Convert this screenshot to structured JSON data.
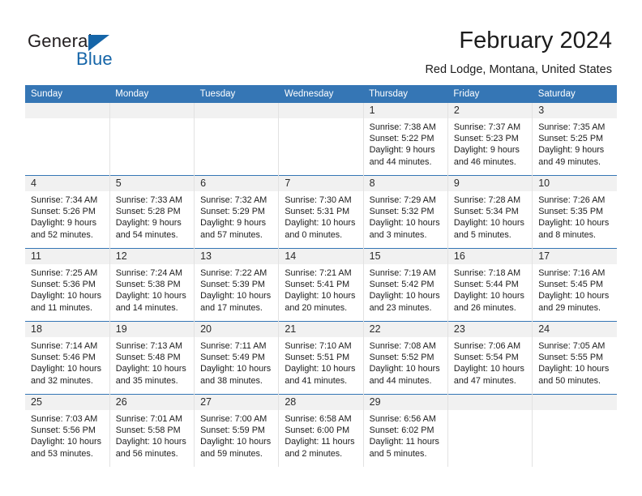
{
  "brand": {
    "name_part1": "General",
    "name_part2": "Blue",
    "logo_icon": "triangle-logo"
  },
  "header": {
    "title": "February 2024",
    "subtitle": "Red Lodge, Montana, United States"
  },
  "colors": {
    "header_band": "#3576b5",
    "daynum_band": "#f1f1f1",
    "brand_blue": "#1565a8",
    "text": "#1c1c1c"
  },
  "weekdays": [
    "Sunday",
    "Monday",
    "Tuesday",
    "Wednesday",
    "Thursday",
    "Friday",
    "Saturday"
  ],
  "weeks": [
    [
      {
        "day": "",
        "blank": true
      },
      {
        "day": "",
        "blank": true
      },
      {
        "day": "",
        "blank": true
      },
      {
        "day": "",
        "blank": true
      },
      {
        "day": "1",
        "sunrise": "Sunrise: 7:38 AM",
        "sunset": "Sunset: 5:22 PM",
        "daylight1": "Daylight: 9 hours",
        "daylight2": "and 44 minutes."
      },
      {
        "day": "2",
        "sunrise": "Sunrise: 7:37 AM",
        "sunset": "Sunset: 5:23 PM",
        "daylight1": "Daylight: 9 hours",
        "daylight2": "and 46 minutes."
      },
      {
        "day": "3",
        "sunrise": "Sunrise: 7:35 AM",
        "sunset": "Sunset: 5:25 PM",
        "daylight1": "Daylight: 9 hours",
        "daylight2": "and 49 minutes."
      }
    ],
    [
      {
        "day": "4",
        "sunrise": "Sunrise: 7:34 AM",
        "sunset": "Sunset: 5:26 PM",
        "daylight1": "Daylight: 9 hours",
        "daylight2": "and 52 minutes."
      },
      {
        "day": "5",
        "sunrise": "Sunrise: 7:33 AM",
        "sunset": "Sunset: 5:28 PM",
        "daylight1": "Daylight: 9 hours",
        "daylight2": "and 54 minutes."
      },
      {
        "day": "6",
        "sunrise": "Sunrise: 7:32 AM",
        "sunset": "Sunset: 5:29 PM",
        "daylight1": "Daylight: 9 hours",
        "daylight2": "and 57 minutes."
      },
      {
        "day": "7",
        "sunrise": "Sunrise: 7:30 AM",
        "sunset": "Sunset: 5:31 PM",
        "daylight1": "Daylight: 10 hours",
        "daylight2": "and 0 minutes."
      },
      {
        "day": "8",
        "sunrise": "Sunrise: 7:29 AM",
        "sunset": "Sunset: 5:32 PM",
        "daylight1": "Daylight: 10 hours",
        "daylight2": "and 3 minutes."
      },
      {
        "day": "9",
        "sunrise": "Sunrise: 7:28 AM",
        "sunset": "Sunset: 5:34 PM",
        "daylight1": "Daylight: 10 hours",
        "daylight2": "and 5 minutes."
      },
      {
        "day": "10",
        "sunrise": "Sunrise: 7:26 AM",
        "sunset": "Sunset: 5:35 PM",
        "daylight1": "Daylight: 10 hours",
        "daylight2": "and 8 minutes."
      }
    ],
    [
      {
        "day": "11",
        "sunrise": "Sunrise: 7:25 AM",
        "sunset": "Sunset: 5:36 PM",
        "daylight1": "Daylight: 10 hours",
        "daylight2": "and 11 minutes."
      },
      {
        "day": "12",
        "sunrise": "Sunrise: 7:24 AM",
        "sunset": "Sunset: 5:38 PM",
        "daylight1": "Daylight: 10 hours",
        "daylight2": "and 14 minutes."
      },
      {
        "day": "13",
        "sunrise": "Sunrise: 7:22 AM",
        "sunset": "Sunset: 5:39 PM",
        "daylight1": "Daylight: 10 hours",
        "daylight2": "and 17 minutes."
      },
      {
        "day": "14",
        "sunrise": "Sunrise: 7:21 AM",
        "sunset": "Sunset: 5:41 PM",
        "daylight1": "Daylight: 10 hours",
        "daylight2": "and 20 minutes."
      },
      {
        "day": "15",
        "sunrise": "Sunrise: 7:19 AM",
        "sunset": "Sunset: 5:42 PM",
        "daylight1": "Daylight: 10 hours",
        "daylight2": "and 23 minutes."
      },
      {
        "day": "16",
        "sunrise": "Sunrise: 7:18 AM",
        "sunset": "Sunset: 5:44 PM",
        "daylight1": "Daylight: 10 hours",
        "daylight2": "and 26 minutes."
      },
      {
        "day": "17",
        "sunrise": "Sunrise: 7:16 AM",
        "sunset": "Sunset: 5:45 PM",
        "daylight1": "Daylight: 10 hours",
        "daylight2": "and 29 minutes."
      }
    ],
    [
      {
        "day": "18",
        "sunrise": "Sunrise: 7:14 AM",
        "sunset": "Sunset: 5:46 PM",
        "daylight1": "Daylight: 10 hours",
        "daylight2": "and 32 minutes."
      },
      {
        "day": "19",
        "sunrise": "Sunrise: 7:13 AM",
        "sunset": "Sunset: 5:48 PM",
        "daylight1": "Daylight: 10 hours",
        "daylight2": "and 35 minutes."
      },
      {
        "day": "20",
        "sunrise": "Sunrise: 7:11 AM",
        "sunset": "Sunset: 5:49 PM",
        "daylight1": "Daylight: 10 hours",
        "daylight2": "and 38 minutes."
      },
      {
        "day": "21",
        "sunrise": "Sunrise: 7:10 AM",
        "sunset": "Sunset: 5:51 PM",
        "daylight1": "Daylight: 10 hours",
        "daylight2": "and 41 minutes."
      },
      {
        "day": "22",
        "sunrise": "Sunrise: 7:08 AM",
        "sunset": "Sunset: 5:52 PM",
        "daylight1": "Daylight: 10 hours",
        "daylight2": "and 44 minutes."
      },
      {
        "day": "23",
        "sunrise": "Sunrise: 7:06 AM",
        "sunset": "Sunset: 5:54 PM",
        "daylight1": "Daylight: 10 hours",
        "daylight2": "and 47 minutes."
      },
      {
        "day": "24",
        "sunrise": "Sunrise: 7:05 AM",
        "sunset": "Sunset: 5:55 PM",
        "daylight1": "Daylight: 10 hours",
        "daylight2": "and 50 minutes."
      }
    ],
    [
      {
        "day": "25",
        "sunrise": "Sunrise: 7:03 AM",
        "sunset": "Sunset: 5:56 PM",
        "daylight1": "Daylight: 10 hours",
        "daylight2": "and 53 minutes."
      },
      {
        "day": "26",
        "sunrise": "Sunrise: 7:01 AM",
        "sunset": "Sunset: 5:58 PM",
        "daylight1": "Daylight: 10 hours",
        "daylight2": "and 56 minutes."
      },
      {
        "day": "27",
        "sunrise": "Sunrise: 7:00 AM",
        "sunset": "Sunset: 5:59 PM",
        "daylight1": "Daylight: 10 hours",
        "daylight2": "and 59 minutes."
      },
      {
        "day": "28",
        "sunrise": "Sunrise: 6:58 AM",
        "sunset": "Sunset: 6:00 PM",
        "daylight1": "Daylight: 11 hours",
        "daylight2": "and 2 minutes."
      },
      {
        "day": "29",
        "sunrise": "Sunrise: 6:56 AM",
        "sunset": "Sunset: 6:02 PM",
        "daylight1": "Daylight: 11 hours",
        "daylight2": "and 5 minutes."
      },
      {
        "day": "",
        "blank": true
      },
      {
        "day": "",
        "blank": true
      }
    ]
  ]
}
